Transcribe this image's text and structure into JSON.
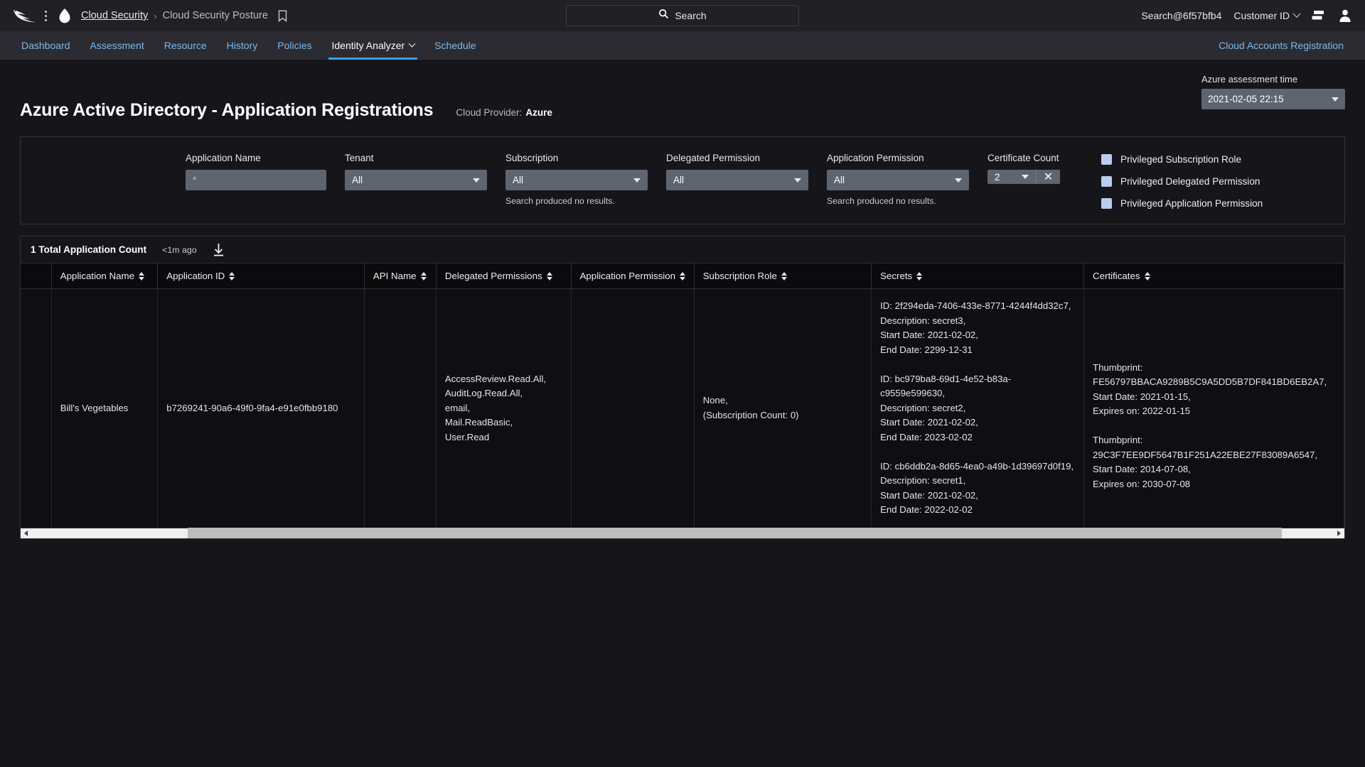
{
  "topbar": {
    "logo_icon": "falcon-logo",
    "menu_icon": "kebab-menu-icon",
    "product_icon": "cloud-icon",
    "breadcrumb_root": "Cloud Security",
    "breadcrumb_sep": "›",
    "breadcrumb_current": "Cloud Security Posture",
    "bookmark_icon": "bookmark-icon",
    "search_placeholder": "Search",
    "search_icon": "search-icon",
    "user_email": "Search@6f57bfb4",
    "customer_id": "Customer ID",
    "customer_chevron_icon": "chevron-down-icon",
    "list_icon": "list-view-icon",
    "avatar_icon": "user-avatar-icon"
  },
  "nav": {
    "items": [
      {
        "label": "Dashboard",
        "active": false
      },
      {
        "label": "Assessment",
        "active": false
      },
      {
        "label": "Resource",
        "active": false
      },
      {
        "label": "History",
        "active": false
      },
      {
        "label": "Policies",
        "active": false
      },
      {
        "label": "Identity Analyzer",
        "active": true,
        "caret": true
      },
      {
        "label": "Schedule",
        "active": false
      }
    ],
    "right_link": "Cloud Accounts Registration"
  },
  "page": {
    "title": "Azure Active Directory - Application Registrations",
    "provider_label": "Cloud Provider:",
    "provider_value": "Azure",
    "assessment_label": "Azure assessment time",
    "assessment_value": "2021-02-05 22:15"
  },
  "filters": [
    {
      "label": "Application Name",
      "type": "text",
      "value": "*",
      "note": ""
    },
    {
      "label": "Tenant",
      "type": "select",
      "value": "All",
      "note": ""
    },
    {
      "label": "Subscription",
      "type": "select",
      "value": "All",
      "note": "Search produced no results."
    },
    {
      "label": "Delegated Permission",
      "type": "select",
      "value": "All",
      "note": ""
    },
    {
      "label": "Application Permission",
      "type": "select",
      "value": "All",
      "note": "Search produced no results."
    },
    {
      "label": "Certificate Count",
      "type": "stepper",
      "value": "2",
      "note": "",
      "clear_icon": "close-icon"
    }
  ],
  "checkboxes": [
    {
      "label": "Privileged Subscription Role",
      "checked": true
    },
    {
      "label": "Privileged Delegated Permission",
      "checked": true
    },
    {
      "label": "Privileged Application Permission",
      "checked": true
    }
  ],
  "table": {
    "count_text": "1 Total Application Count",
    "updated_text": "<1m ago",
    "download_icon": "download-icon",
    "columns": [
      "Application Name",
      "Application ID",
      "API Name",
      "Delegated Permissions",
      "Application Permission",
      "Subscription Role",
      "Secrets",
      "Certificates"
    ],
    "rows": [
      {
        "application_name": "Bill's Vegetables",
        "application_id": "b7269241-90a6-49f0-9fa4-e91e0fbb9180",
        "api_name": "",
        "delegated_permissions": "AccessReview.Read.All,\nAuditLog.Read.All,\nemail,\nMail.ReadBasic,\nUser.Read",
        "application_permission": "",
        "subscription_role": "None,\n(Subscription Count: 0)",
        "secrets": "ID: 2f294eda-7406-433e-8771-4244f4dd32c7,\nDescription: secret3,\nStart Date: 2021-02-02,\nEnd Date: 2299-12-31\n\nID: bc979ba8-69d1-4e52-b83a-c9559e599630,\nDescription: secret2,\nStart Date: 2021-02-02,\nEnd Date: 2023-02-02\n\nID: cb6ddb2a-8d65-4ea0-a49b-1d39697d0f19,\nDescription: secret1,\nStart Date: 2021-02-02,\nEnd Date: 2022-02-02",
        "certificates": "Thumbprint: FE56797BBACA9289B5C9A5DD5B7DF841BD6EB2A7,\nStart Date: 2021-01-15,\nExpires on: 2022-01-15\n\nThumbprint: 29C3F7EE9DF5647B1F251A22EBE27F83089A6547,\nStart Date: 2014-07-08,\nExpires on: 2030-07-08"
      }
    ]
  },
  "scrollbar": {
    "left_arrow_icon": "scroll-left-arrow-icon",
    "right_arrow_icon": "scroll-right-arrow-icon"
  },
  "colors": {
    "accent": "#3f9ee4",
    "link": "#7ab8ef",
    "control": "#5c6570",
    "checkbox": "#b8cdf0",
    "page_bg": "#16161a",
    "topbar_bg": "#202025",
    "navbar_bg": "#2b2b31"
  }
}
